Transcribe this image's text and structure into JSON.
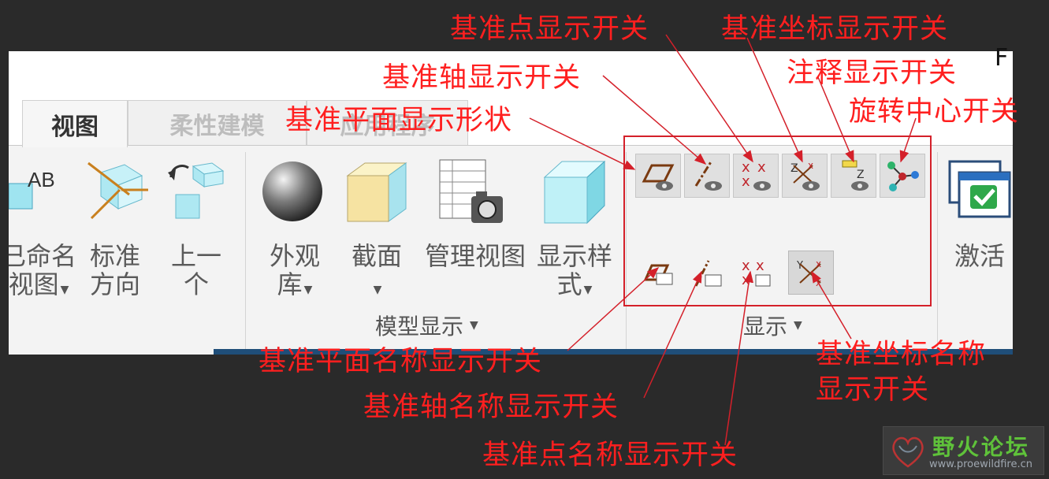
{
  "ribbon": {
    "tabs": [
      {
        "label": "视图",
        "active": true
      },
      {
        "label": "柔性建模",
        "active": false
      },
      {
        "label": "应用程序",
        "active": false
      }
    ],
    "corner_text": "F",
    "view_tools": {
      "named_views": {
        "label_1": "已命名",
        "label_2": "视图",
        "icon": "named-view-icon"
      },
      "standard_orientation": {
        "label_1": "标准",
        "label_2": "方向",
        "icon": "standard-orientation-icon"
      },
      "previous": {
        "label_1": "上一",
        "label_2": "个",
        "icon": "previous-view-icon"
      }
    },
    "model_display": {
      "group_label": "模型显示",
      "appearance_library": {
        "label_1": "外观",
        "label_2": "库",
        "icon": "appearance-sphere-icon"
      },
      "section": {
        "label": "截面",
        "icon": "section-icon"
      },
      "manage_views": {
        "label": "管理视图",
        "icon": "manage-views-icon"
      },
      "display_style": {
        "label_1": "显示样",
        "label_2": "式",
        "icon": "display-style-cube-icon"
      }
    },
    "display": {
      "group_label": "显示",
      "buttons_row1": [
        "datum-plane-display-icon",
        "datum-axis-display-icon",
        "datum-point-display-icon",
        "datum-csys-display-icon",
        "annotation-display-icon",
        "spin-center-icon"
      ],
      "buttons_row2": [
        "datum-plane-tag-icon",
        "datum-axis-tag-icon",
        "datum-point-tag-icon",
        "datum-csys-tag-icon"
      ]
    },
    "activate": {
      "label": "激活",
      "icon": "activate-check-icon"
    }
  },
  "annotations": {
    "point_display": "基准点显示开关",
    "csys_display": "基准坐标显示开关",
    "axis_display": "基准轴显示开关",
    "annotation_display": "注释显示开关",
    "plane_display": "基准平面显示形状",
    "spin_center": "旋转中心开关",
    "plane_tag": "基准平面名称显示开关",
    "csys_tag_line1": "基准坐标名称",
    "csys_tag_line2": "显示开关",
    "axis_tag": "基准轴名称显示开关",
    "point_tag": "基准点名称显示开关"
  },
  "watermark": {
    "title": "野火论坛",
    "url": "www.proewildfire.cn"
  },
  "colors": {
    "annotation_red": "#ff1f1f",
    "box_red": "#d4202a",
    "logo_green": "#5fc23a",
    "accent_blue": "#1f4e79"
  }
}
